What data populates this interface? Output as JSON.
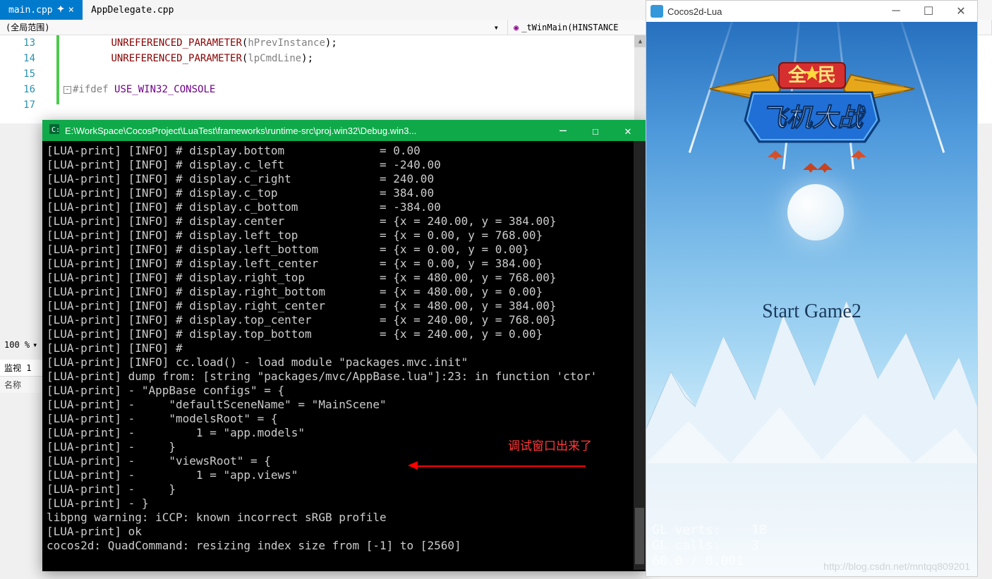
{
  "tabs": [
    {
      "label": "main.cpp",
      "active": true
    },
    {
      "label": "AppDelegate.cpp",
      "active": false
    }
  ],
  "scope": {
    "global": "(全局范围)",
    "right_icon": "◉",
    "right_text": "_tWinMain(HINSTANCE"
  },
  "code": {
    "lines": [
      {
        "num": "13",
        "content_parts": [
          {
            "t": "        ",
            "c": ""
          },
          {
            "t": "UNREFERENCED_PARAMETER",
            "c": "func"
          },
          {
            "t": "(",
            "c": ""
          },
          {
            "t": "hPrevInstance",
            "c": "param"
          },
          {
            "t": ");",
            "c": ""
          }
        ]
      },
      {
        "num": "14",
        "content_parts": [
          {
            "t": "        ",
            "c": ""
          },
          {
            "t": "UNREFERENCED_PARAMETER",
            "c": "func"
          },
          {
            "t": "(",
            "c": ""
          },
          {
            "t": "lpCmdLine",
            "c": "param"
          },
          {
            "t": ");",
            "c": ""
          }
        ]
      },
      {
        "num": "15",
        "content_parts": []
      },
      {
        "num": "16",
        "content_parts": [
          {
            "t": "#ifdef ",
            "c": "preproc"
          },
          {
            "t": "USE_WIN32_CONSOLE",
            "c": "macro"
          }
        ],
        "collapse": true
      },
      {
        "num": "17",
        "content_parts": []
      }
    ]
  },
  "zoom": "100 %",
  "watch": {
    "tab": "监视 1",
    "header": "名称"
  },
  "console": {
    "title": "E:\\WorkSpace\\CocosProject\\LuaTest\\frameworks\\runtime-src\\proj.win32\\Debug.win3...",
    "lines": [
      "[LUA-print] [INFO] # display.bottom              = 0.00",
      "[LUA-print] [INFO] # display.c_left              = -240.00",
      "[LUA-print] [INFO] # display.c_right             = 240.00",
      "[LUA-print] [INFO] # display.c_top               = 384.00",
      "[LUA-print] [INFO] # display.c_bottom            = -384.00",
      "[LUA-print] [INFO] # display.center              = {x = 240.00, y = 384.00}",
      "[LUA-print] [INFO] # display.left_top            = {x = 0.00, y = 768.00}",
      "[LUA-print] [INFO] # display.left_bottom         = {x = 0.00, y = 0.00}",
      "[LUA-print] [INFO] # display.left_center         = {x = 0.00, y = 384.00}",
      "[LUA-print] [INFO] # display.right_top           = {x = 480.00, y = 768.00}",
      "[LUA-print] [INFO] # display.right_bottom        = {x = 480.00, y = 0.00}",
      "[LUA-print] [INFO] # display.right_center        = {x = 480.00, y = 384.00}",
      "[LUA-print] [INFO] # display.top_center          = {x = 240.00, y = 768.00}",
      "[LUA-print] [INFO] # display.top_bottom          = {x = 240.00, y = 0.00}",
      "[LUA-print] [INFO] #",
      "[LUA-print] [INFO] cc.load() - load module \"packages.mvc.init\"",
      "[LUA-print] dump from: [string \"packages/mvc/AppBase.lua\"]:23: in function 'ctor'",
      "[LUA-print] - \"AppBase configs\" = {",
      "[LUA-print] -     \"defaultSceneName\" = \"MainScene\"",
      "[LUA-print] -     \"modelsRoot\" = {",
      "[LUA-print] -         1 = \"app.models\"",
      "[LUA-print] -     }",
      "[LUA-print] -     \"viewsRoot\" = {",
      "[LUA-print] -         1 = \"app.views\"",
      "[LUA-print] -     }",
      "[LUA-print] - }",
      "libpng warning: iCCP: known incorrect sRGB profile",
      "[LUA-print] ok",
      "cocos2d: QuadCommand: resizing index size from [-1] to [2560]"
    ]
  },
  "annotation": "调试窗口出来了",
  "game": {
    "title": "Cocos2d-Lua",
    "logo_top": "全 民",
    "logo_bottom": "飞机大战",
    "start_label": "Start Game2",
    "stats": "GL verts:    18\nGL calls:    3\n60.0 / 0.001",
    "watermark": "http://blog.csdn.net/mntqq809201"
  }
}
